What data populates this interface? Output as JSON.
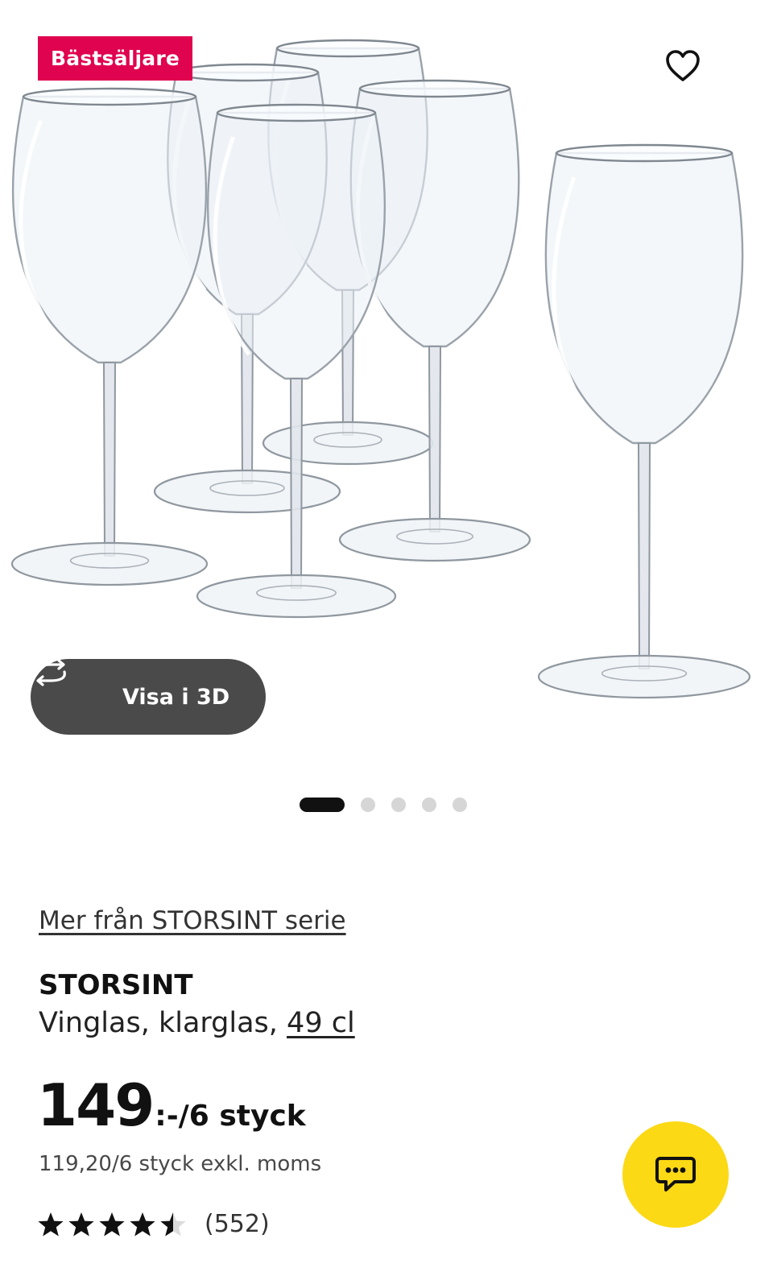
{
  "hero": {
    "badge": "Bästsäljare",
    "favorite_icon": "heart-outline-icon",
    "view3d": {
      "label": "Visa i 3D",
      "icon": "rotate-3d-icon"
    },
    "carousel": {
      "total": 5,
      "active_index": 0
    }
  },
  "product": {
    "series_link": "Mer från STORSINT serie",
    "name": "STORSINT",
    "description": "Vinglas, klarglas, ",
    "size_link": "49 cl",
    "price_main": "149",
    "price_unit": ":-/6 styck",
    "price_ex_vat": "119,20/6 styck exkl. moms",
    "rating": {
      "stars": 4.5,
      "max": 5,
      "count": "(552)"
    }
  },
  "chat": {
    "icon": "chat-bubble-icon",
    "color": "#fbd914"
  },
  "colors": {
    "badge": "#e0034f",
    "view3d_button": "#4a4a4a",
    "chat_button": "#fbd914"
  }
}
